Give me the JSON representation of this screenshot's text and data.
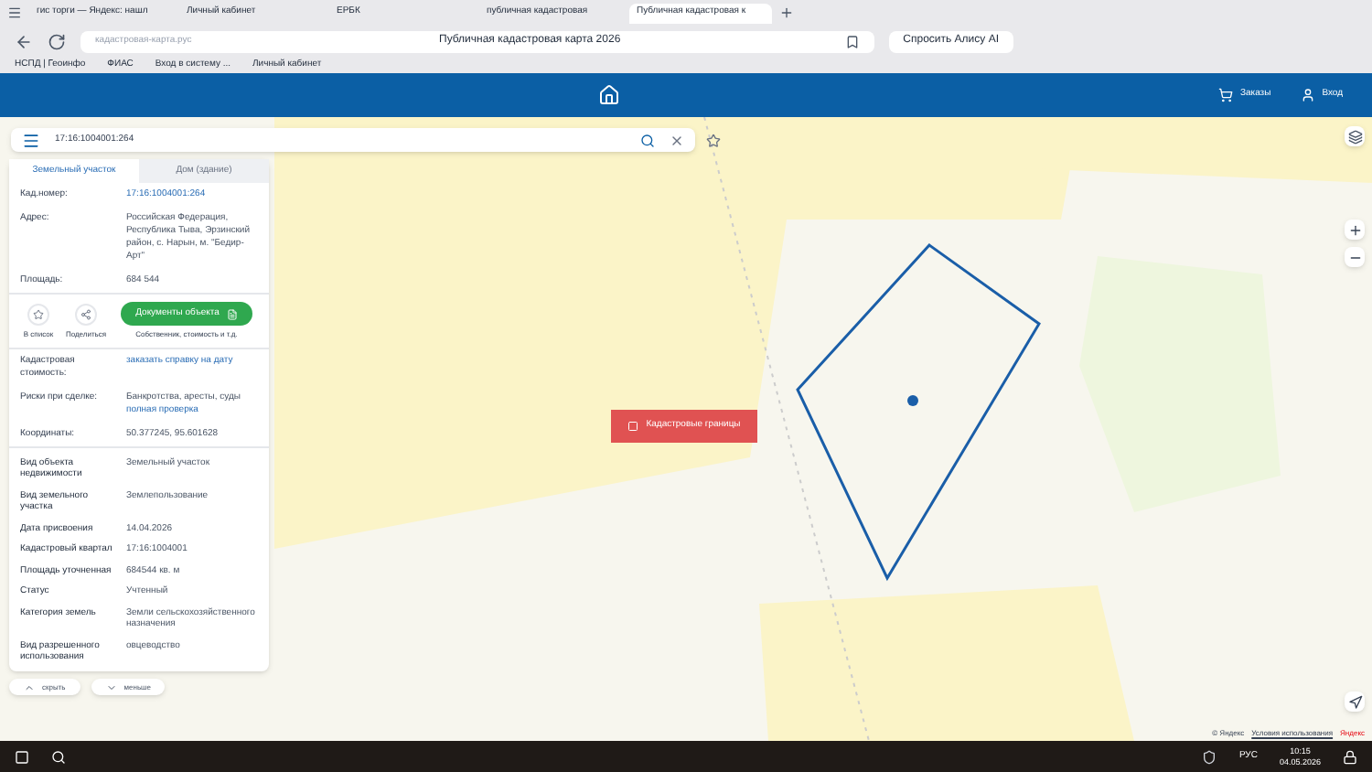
{
  "browser": {
    "tabs": [
      {
        "label": "гис торги — Яндекс: нашл",
        "selected": false
      },
      {
        "label": "Личный кабинет",
        "selected": false
      },
      {
        "label": "ЕРБК",
        "selected": false
      },
      {
        "label": "публичная кадастровая",
        "selected": false
      },
      {
        "label": "Публичная кадастровая к",
        "selected": true
      }
    ],
    "address": "кадастровая-карта.рус",
    "page_title": "Публичная кадастровая карта 2026",
    "alice_button": "Спросить Алису AI",
    "bookmarks": [
      "НСПД | Геоинфо",
      "ФИАС",
      "Вход в систему ...",
      "Личный кабинет"
    ]
  },
  "header": {
    "orders": "Заказы",
    "login": "Вход"
  },
  "search": {
    "value": "17:16:1004001:264"
  },
  "panel": {
    "tabs": [
      {
        "label": "Земельный участок",
        "selected": true,
        "disabled": false
      },
      {
        "label": "Дом (здание)",
        "selected": false,
        "disabled": true
      }
    ],
    "top_fields": [
      {
        "label": "Кад.номер:",
        "value": "17:16:1004001:264",
        "kind": "link"
      },
      {
        "label": "Адрес:",
        "value": "Российская Федерация, Республика Тыва, Эрзинский район, с. Нарын, м. \"Бедир-Арт\"",
        "kind": "text"
      },
      {
        "label": "Площадь:",
        "value": "684 544",
        "kind": "text"
      }
    ],
    "actions": {
      "favorite": "В список",
      "share": "Поделиться",
      "documents": "Документы объекта",
      "documents_note": "Собственник, стоимость и т.д."
    },
    "mid_fields": [
      {
        "label": "Кадастровая стоимость:",
        "value": "заказать справку на дату",
        "kind": "link"
      },
      {
        "label": "Риски при сделке:",
        "value": "Банкротства, аресты, суды",
        "link": "полная проверка",
        "kind": "mixed"
      },
      {
        "label": "Координаты:",
        "value": "50.377245, 95.601628",
        "kind": "text"
      }
    ],
    "fields": [
      {
        "label": "Вид объекта недвижимости",
        "value": "Земельный участок"
      },
      {
        "label": "Вид земельного участка",
        "value": "Землепользование"
      },
      {
        "label": "Дата присвоения",
        "value": "14.04.2026"
      },
      {
        "label": "Кадастровый квартал",
        "value": "17:16:1004001"
      },
      {
        "label": "Площадь уточненная",
        "value": "684544 кв. м"
      },
      {
        "label": "Статус",
        "value": "Учтенный"
      },
      {
        "label": "Категория земель",
        "value": "Земли сельскохозяйственного назначения"
      },
      {
        "label": "Вид разрешенного использования",
        "value": "овцеводство"
      }
    ],
    "hide": "скрыть",
    "less": "меньше"
  },
  "map": {
    "boundaries_button": "Кадастровые границы",
    "copyright": "© Яндекс",
    "terms": "Условия использования",
    "brand": "Яндекс"
  },
  "taskbar": {
    "lang": "РУС",
    "time": "10:15",
    "date": "04.05.2026"
  }
}
